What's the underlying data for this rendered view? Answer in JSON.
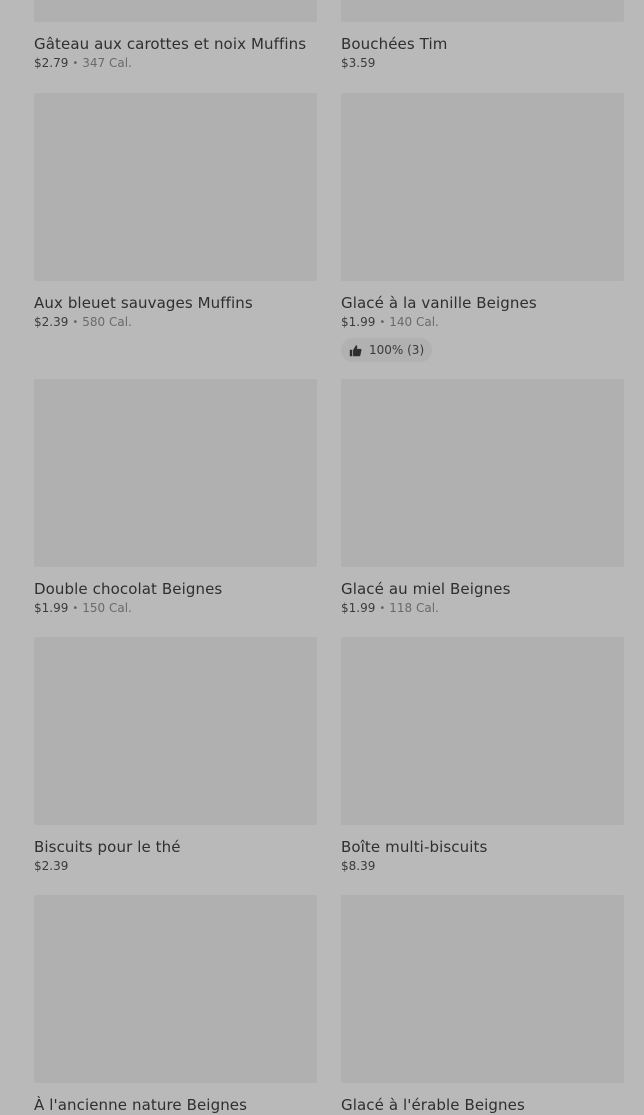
{
  "items": [
    {
      "name": "Gâteau aux carottes et noix Muffins",
      "price": "$2.79",
      "calories": "347 Cal."
    },
    {
      "name": "Bouchées Tim",
      "price": "$3.59",
      "calories": ""
    },
    {
      "name": "Aux bleuet sauvages Muffins",
      "price": "$2.39",
      "calories": "580 Cal."
    },
    {
      "name": "Glacé à la vanille Beignes",
      "price": "$1.99",
      "calories": "140 Cal.",
      "rating": "100% (3)"
    },
    {
      "name": "Double chocolat Beignes",
      "price": "$1.99",
      "calories": "150 Cal."
    },
    {
      "name": "Glacé au miel Beignes",
      "price": "$1.99",
      "calories": "118 Cal."
    },
    {
      "name": "Biscuits pour le thé",
      "price": "$2.39",
      "calories": ""
    },
    {
      "name": "Boîte multi-biscuits",
      "price": "$8.39",
      "calories": ""
    },
    {
      "name": "À l'ancienne nature Beignes",
      "price": "",
      "calories": ""
    },
    {
      "name": "Glacé à l'érable Beignes",
      "price": "",
      "calories": ""
    }
  ],
  "rating_icon": "thumbs-up-icon",
  "colors": {
    "background": "#b9b9b9",
    "thumbnail": "#b0b0b0",
    "title_text": "#2f2f2f",
    "calorie_text": "#6a6a6a"
  }
}
